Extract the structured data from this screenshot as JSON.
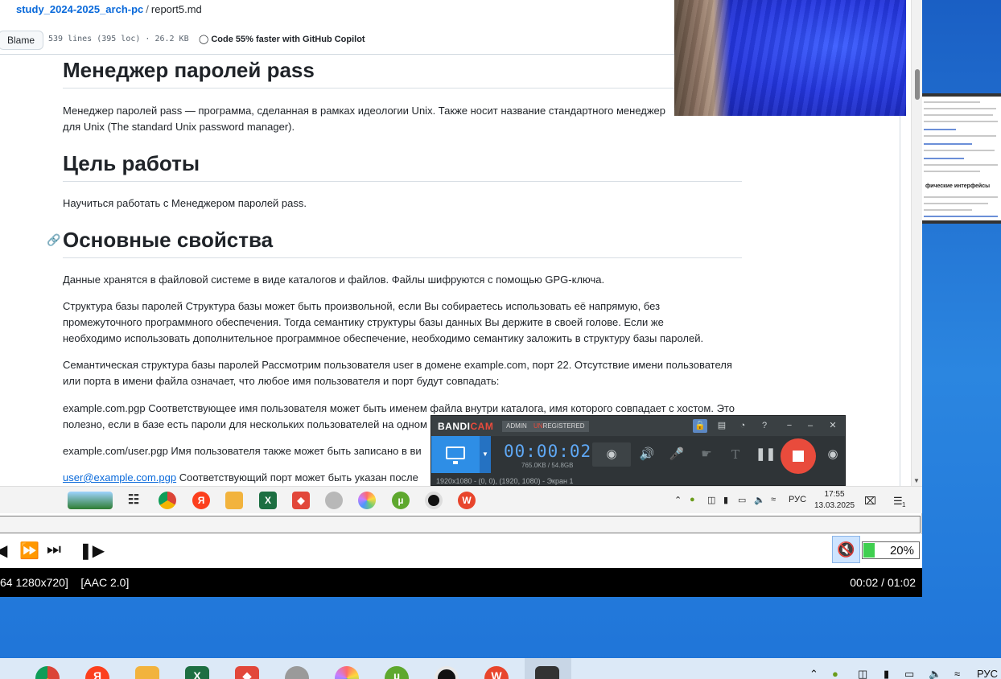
{
  "github": {
    "repo": "study_2024-2025_arch-pc",
    "separator": "/",
    "file": "report5.md",
    "blame_label": "Blame",
    "file_meta": "539 lines (395 loc) · 26.2 KB",
    "copilot_label": "Code 55% faster with GitHub Copilot",
    "h_pass": "Менеджер паролей pass",
    "p_intro_1": "Менеджер паролей pass — программа, сделанная в рамках идеологии Unix. Также носит название стандартного менеджер",
    "p_intro_2": "для Unix (The standard Unix password manager).",
    "h_goal": "Цель работы",
    "p_goal": "Научиться работать с Менеджером паролей pass.",
    "h_props": "Основные свойства",
    "p_props_1": "Данные хранятся в файловой системе в виде каталогов и файлов. Файлы шифруются с помощью GPG-ключа.",
    "p_struct_1": "Структура базы паролей Структура базы может быть произвольной, если Вы собираетесь использовать её напрямую, без",
    "p_struct_2": "промежуточного программного обеспечения. Тогда семантику структуры базы данных Вы держите в своей голове. Если же",
    "p_struct_3": "необходимо использовать дополнительное программное обеспечение, необходимо семантику заложить в структуру базы паролей.",
    "p_sem_1": "Семантическая структура базы паролей Рассмотрим пользователя user в домене example.com, порт 22. Отсутствие имени пользователя",
    "p_sem_2": "или порта в имени файла означает, что любое имя пользователя и порт будут совпадать:",
    "p_ex_1": "example.com.pgp Соответствующее имя пользователя может быть именем файла внутри каталога, имя которого совпадает с хостом. Это",
    "p_ex_2": "полезно, если в базе есть пароли для нескольких пользователей на одном",
    "p_user": "example.com/user.pgp Имя пользователя также может быть записано в ви",
    "p_port_link": "user@example.com.pgp",
    "p_port_rest": " Соответствующий порт может быть указан после ",
    "thumb_heading": "фические интерфейсы"
  },
  "recorded_taskbar": {
    "lang": "РУС",
    "time": "17:55",
    "date": "13.03.2025",
    "notif_count": "1"
  },
  "bandicam": {
    "logo_bandi": "BANDI",
    "logo_cam": "CAM",
    "badge_admin": "ADMIN",
    "badge_un": "UN",
    "badge_registered": "REGISTERED",
    "timer": "00:00:02",
    "size": "765.0KB / 54.8GB",
    "status": "1920x1080 - (0, 0), (1920, 1080) - Экран 1"
  },
  "player": {
    "volume": "20%",
    "volume_level": 0.2,
    "status_codec": "64 1280x720]",
    "status_audio": "[AAC 2.0]",
    "status_time": "00:02 / 01:02"
  },
  "taskbar": {
    "lang": "РУС"
  },
  "colors": {
    "accent_link": "#0969da",
    "bandicam_rec": "#e94b3c",
    "bandicam_timer": "#5fa8f5",
    "volume_fill": "#3fcf4f"
  }
}
